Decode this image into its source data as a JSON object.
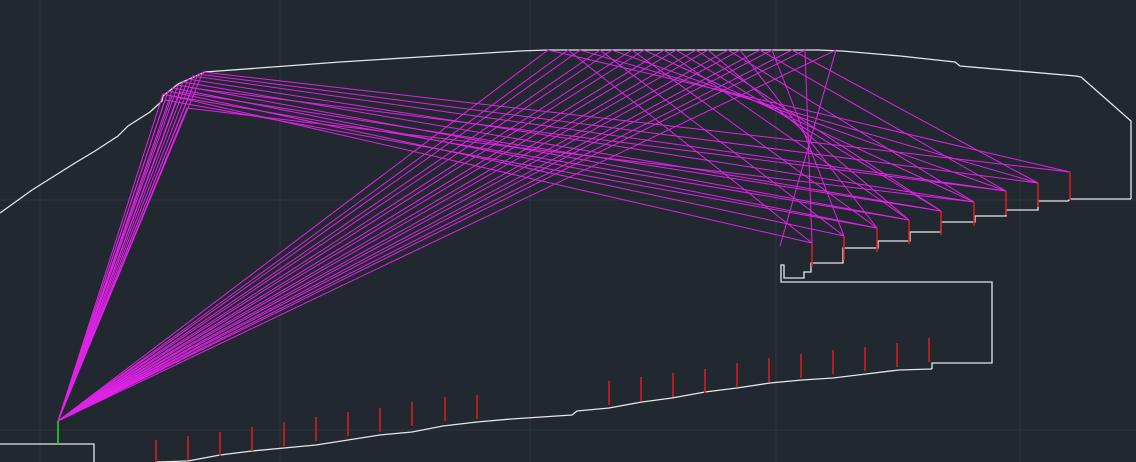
{
  "viewport": {
    "canvas": "cad-model-space",
    "background": "#212830",
    "grid": true
  },
  "colors": {
    "background": "#212830",
    "grid": "#2b333c",
    "outline": "#e6e6e6",
    "ray": "#e022e6",
    "seat_tick": "#d21e1e",
    "source_marker": "#2ed12e"
  },
  "entities": {
    "outline_count": 4,
    "ray_fan_count": 3,
    "seat_tick_count": 32
  }
}
